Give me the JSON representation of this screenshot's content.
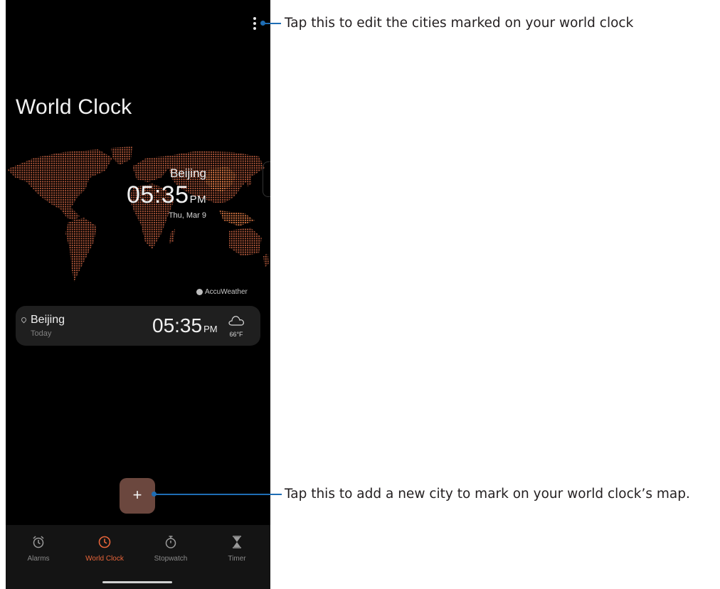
{
  "app": {
    "title": "World Clock",
    "menu_icon": "more-vertical-icon"
  },
  "map": {
    "city": "Beijing",
    "time": "05:35",
    "ampm": "PM",
    "date": "Thu, Mar 9",
    "provider": "AccuWeather",
    "dot_color": "#b85a3c",
    "highlight_color": "#e07a45"
  },
  "city_card": {
    "city": "Beijing",
    "day": "Today",
    "time": "05:35",
    "ampm": "PM",
    "weather_icon": "cloud-icon",
    "temperature": "66°F"
  },
  "fab": {
    "label": "+"
  },
  "nav": {
    "items": [
      {
        "label": "Alarms",
        "icon": "alarm-clock-icon",
        "active": false
      },
      {
        "label": "World Clock",
        "icon": "clock-icon",
        "active": true
      },
      {
        "label": "Stopwatch",
        "icon": "stopwatch-icon",
        "active": false
      },
      {
        "label": "Timer",
        "icon": "hourglass-icon",
        "active": false
      }
    ],
    "accent_color": "#e8653a"
  },
  "annotations": {
    "menu_note": "Tap this to edit the cities marked on your world clock",
    "add_note": "Tap this to add a new city to mark on your world clock’s map.",
    "line_color": "#1e6db4"
  }
}
